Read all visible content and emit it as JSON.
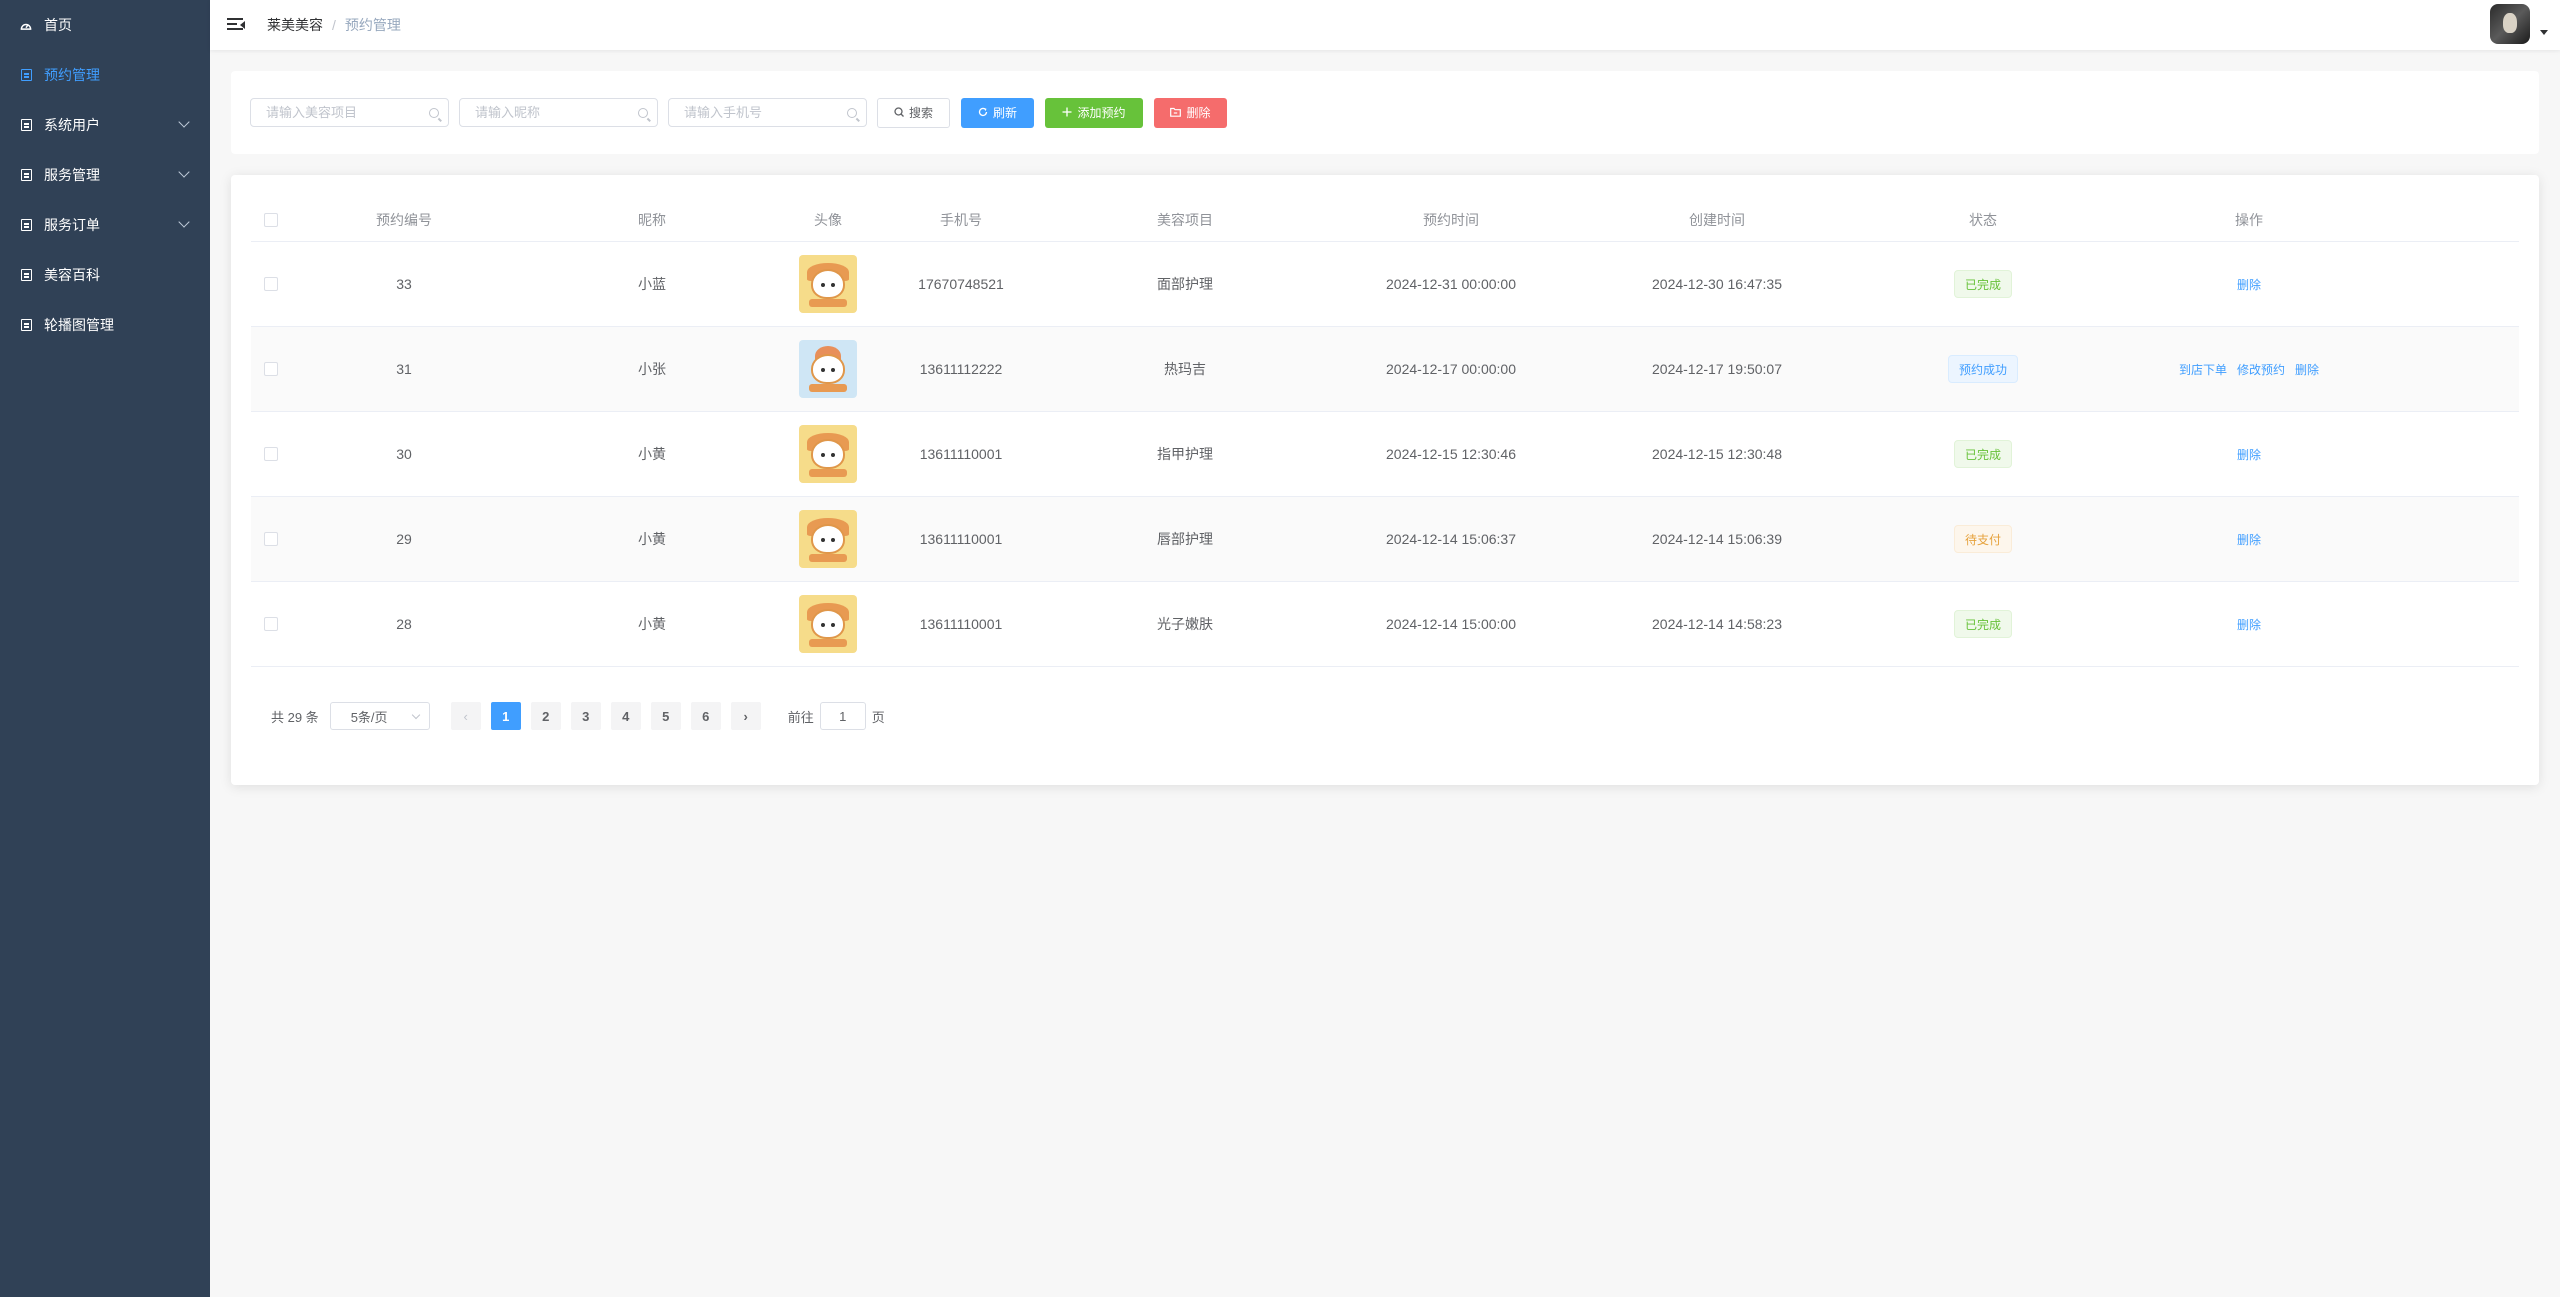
{
  "sidebar": {
    "items": [
      {
        "label": "首页",
        "icon": "dashboard-icon"
      },
      {
        "label": "预约管理",
        "icon": "document-icon",
        "active": true
      },
      {
        "label": "系统用户",
        "icon": "document-icon",
        "submenu": true
      },
      {
        "label": "服务管理",
        "icon": "document-icon",
        "submenu": true
      },
      {
        "label": "服务订单",
        "icon": "document-icon",
        "submenu": true
      },
      {
        "label": "美容百科",
        "icon": "document-icon"
      },
      {
        "label": "轮播图管理",
        "icon": "document-icon"
      }
    ]
  },
  "header": {
    "breadcrumb": [
      "莱美美容",
      "/",
      "预约管理"
    ]
  },
  "search": {
    "project_placeholder": "请输入美容项目",
    "nickname_placeholder": "请输入昵称",
    "phone_placeholder": "请输入手机号",
    "search_label": "搜索",
    "refresh_label": "刷新",
    "add_label": "添加预约",
    "delete_label": "删除"
  },
  "table": {
    "headers": [
      "预约编号",
      "昵称",
      "头像",
      "手机号",
      "美容项目",
      "预约时间",
      "创建时间",
      "状态",
      "操作"
    ],
    "rows": [
      {
        "id": "33",
        "nickname": "小蓝",
        "avatar": "yellow",
        "phone": "17670748521",
        "project": "面部护理",
        "appt_time": "2024-12-31 00:00:00",
        "created": "2024-12-30 16:47:35",
        "status": "已完成",
        "status_type": "success",
        "ops": [
          "删除"
        ]
      },
      {
        "id": "31",
        "nickname": "小张",
        "avatar": "blue",
        "phone": "13611112222",
        "project": "热玛吉",
        "appt_time": "2024-12-17 00:00:00",
        "created": "2024-12-17 19:50:07",
        "status": "预约成功",
        "status_type": "info",
        "ops": [
          "到店下单",
          "修改预约",
          "删除"
        ]
      },
      {
        "id": "30",
        "nickname": "小黄",
        "avatar": "yellow",
        "phone": "13611110001",
        "project": "指甲护理",
        "appt_time": "2024-12-15 12:30:46",
        "created": "2024-12-15 12:30:48",
        "status": "已完成",
        "status_type": "success",
        "ops": [
          "删除"
        ]
      },
      {
        "id": "29",
        "nickname": "小黄",
        "avatar": "yellow",
        "phone": "13611110001",
        "project": "唇部护理",
        "appt_time": "2024-12-14 15:06:37",
        "created": "2024-12-14 15:06:39",
        "status": "待支付",
        "status_type": "warn",
        "ops": [
          "删除"
        ]
      },
      {
        "id": "28",
        "nickname": "小黄",
        "avatar": "yellow",
        "phone": "13611110001",
        "project": "光子嫩肤",
        "appt_time": "2024-12-14 15:00:00",
        "created": "2024-12-14 14:58:23",
        "status": "已完成",
        "status_type": "success",
        "ops": [
          "删除"
        ]
      }
    ]
  },
  "pagination": {
    "total_text": "共 29 条",
    "page_size": "5条/页",
    "pages": [
      "1",
      "2",
      "3",
      "4",
      "5",
      "6"
    ],
    "current": "1",
    "prev": "‹",
    "next": "›",
    "goto_prefix": "前往",
    "goto_value": "1",
    "goto_suffix": "页"
  },
  "colors": {
    "sidebar_bg": "#304156",
    "primary": "#409eff",
    "success": "#67c23a",
    "danger": "#f56c6c",
    "warning": "#e6a23c"
  }
}
